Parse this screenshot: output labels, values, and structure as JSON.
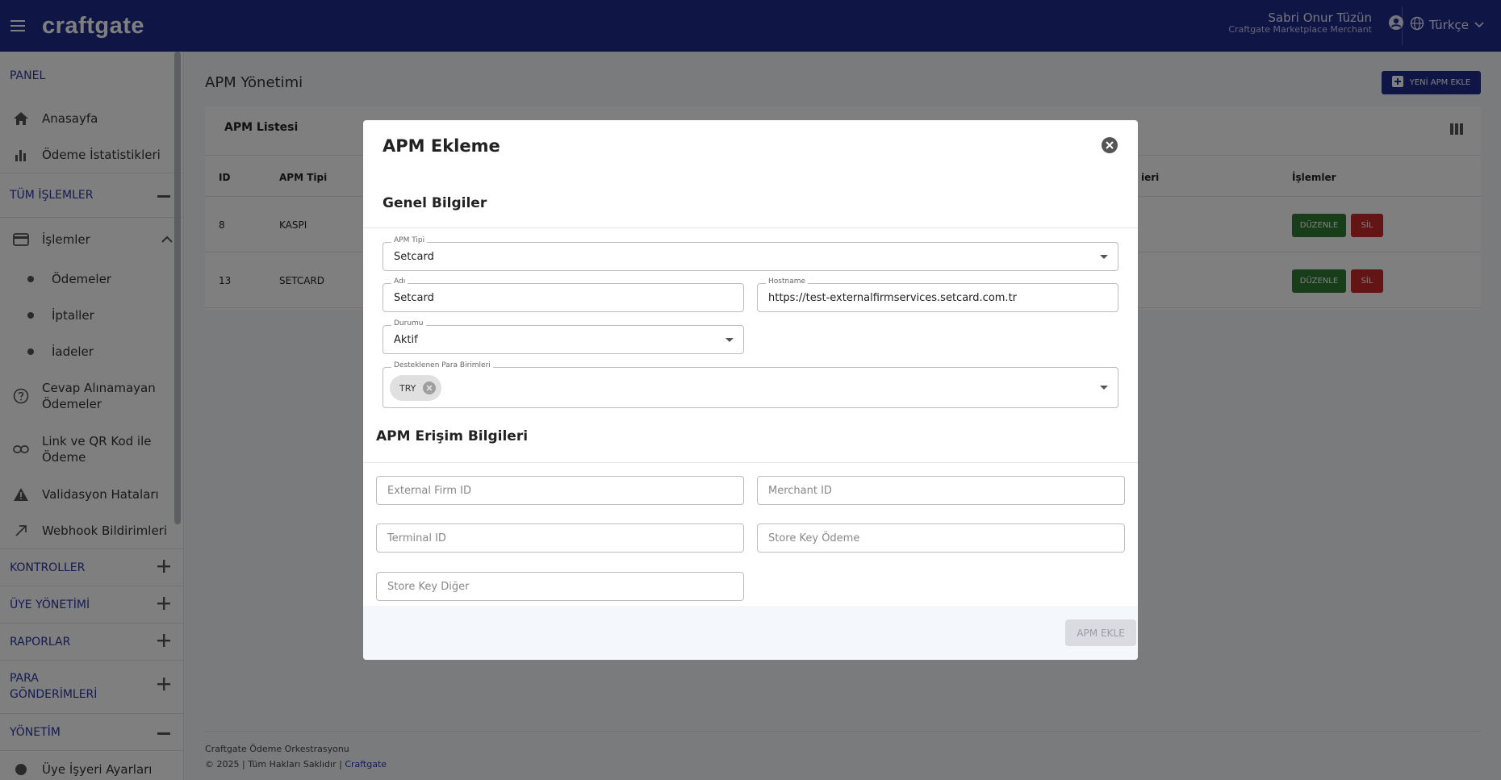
{
  "app": {
    "logo": "craftgate"
  },
  "user": {
    "name": "Sabri Onur Tüzün",
    "merchant": "Craftgate Marketplace Merchant"
  },
  "language": {
    "selected": "Türkçe"
  },
  "sidebar": {
    "panel": "PANEL",
    "home": "Anasayfa",
    "stats": "Ödeme İstatistikleri",
    "all_tx": "TÜM İŞLEMLER",
    "tx": "İşlemler",
    "payments": "Ödemeler",
    "cancels": "İptaller",
    "refunds": "İadeler",
    "unanswered": "Cevap Alınamayan Ödemeler",
    "link_qr": "Link ve QR Kod ile Ödeme",
    "validation": "Validasyon Hataları",
    "webhook": "Webhook Bildirimleri",
    "controls": "KONTROLLER",
    "members": "ÜYE YÖNETİMİ",
    "reports": "RAPORLAR",
    "transfers": "PARA GÖNDERİMLERİ",
    "management": "YÖNETİM",
    "settings_partial": "Üye İşyeri Ayarları"
  },
  "main": {
    "title": "APM Yönetimi",
    "new_button": "YENİ APM EKLE",
    "card_title": "APM Listesi",
    "columns": {
      "id": "ID",
      "type": "APM Tipi",
      "partial": "ieri",
      "actions": "İşlemler"
    },
    "rows": [
      {
        "id": "8",
        "type": "KASPI"
      },
      {
        "id": "13",
        "type": "SETCARD"
      }
    ],
    "edit_label": "DÜZENLE",
    "delete_label": "SİL"
  },
  "footer": {
    "line1": "Craftgate Ödeme Orkestrasyonu",
    "line2": "© 2025 | Tüm Hakları Saklıdır |",
    "link": "Craftgate"
  },
  "modal": {
    "title": "APM Ekleme",
    "general_section": "Genel Bilgiler",
    "apm_type": {
      "label": "APM Tipi",
      "value": "Setcard"
    },
    "name": {
      "label": "Adı",
      "value": "Setcard"
    },
    "hostname": {
      "label": "Hostname",
      "value": "https://test-externalfirmservices.setcard.com.tr"
    },
    "status": {
      "label": "Durumu",
      "value": "Aktif"
    },
    "currencies": {
      "label": "Desteklenen Para Birimleri",
      "chips": [
        "TRY"
      ]
    },
    "access_section": "APM Erişim Bilgileri",
    "external_firm_id": {
      "placeholder": "External Firm ID"
    },
    "merchant_id": {
      "placeholder": "Merchant ID"
    },
    "terminal_id": {
      "placeholder": "Terminal ID"
    },
    "store_key_payment": {
      "placeholder": "Store Key Ödeme"
    },
    "store_key_other": {
      "placeholder": "Store Key Diğer"
    },
    "submit": "APM EKLE"
  },
  "colors": {
    "brand": "#1f2a8a",
    "edit": "#2e7d32",
    "delete": "#c62828"
  }
}
